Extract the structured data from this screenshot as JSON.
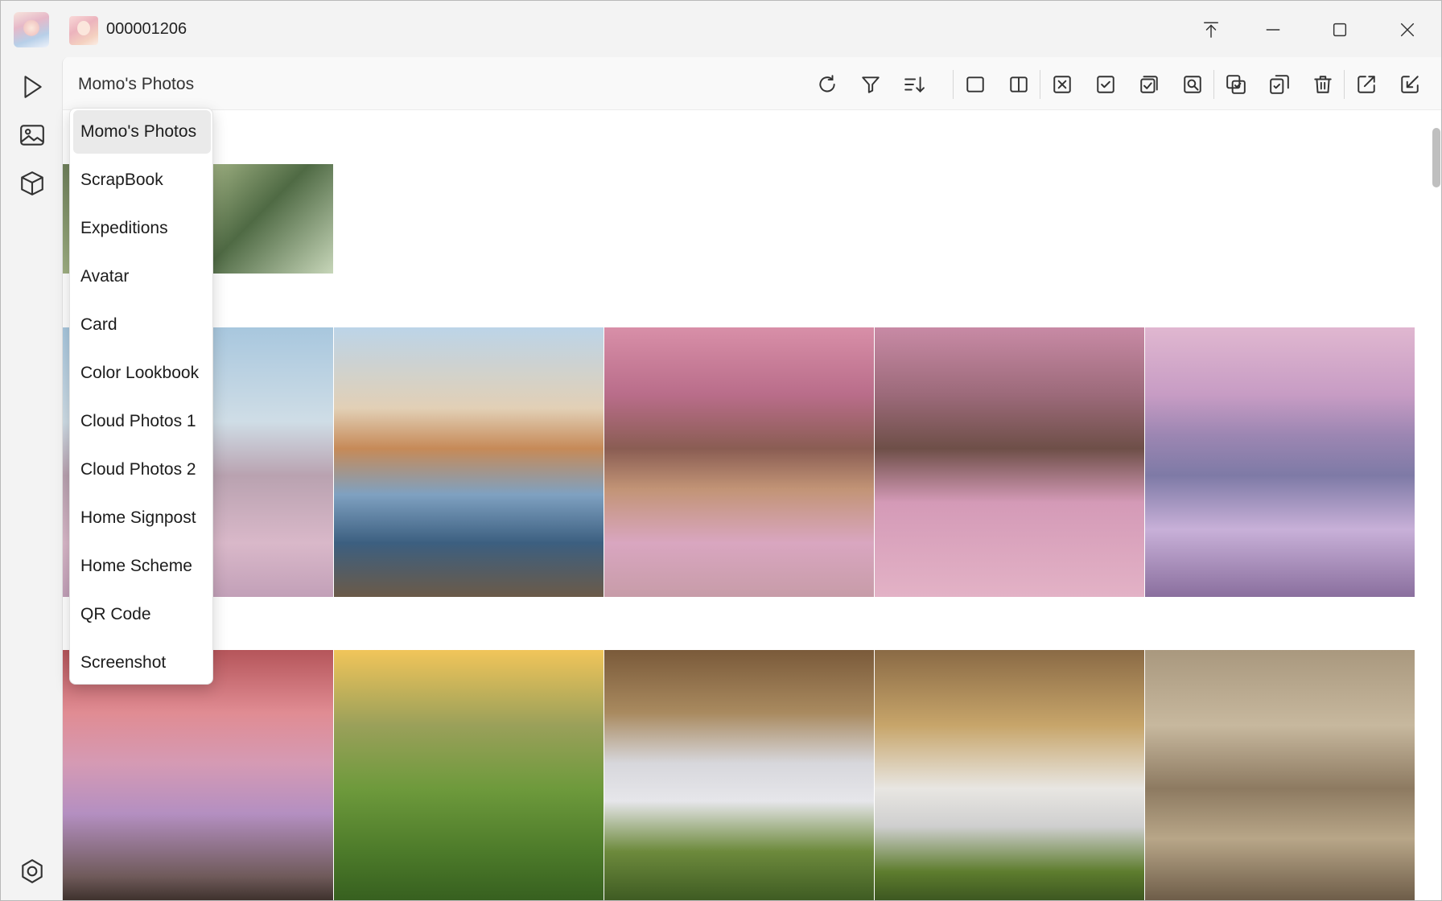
{
  "titlebar": {
    "uid": "000001206",
    "controls": {
      "pin": "pin-top-icon",
      "minimize": "minimize-icon",
      "maximize": "maximize-icon",
      "close": "close-icon"
    }
  },
  "nav": {
    "items": [
      {
        "name": "play",
        "icon": "play-icon"
      },
      {
        "name": "photos",
        "icon": "image-icon"
      },
      {
        "name": "models",
        "icon": "cube-icon"
      }
    ],
    "settings_icon": "settings-icon"
  },
  "toolbar": {
    "album_selected": "Momo's Photos",
    "tools": [
      "refresh-icon",
      "filter-icon",
      "sort-icon",
      "single-view-icon",
      "split-view-icon",
      "deselect-icon",
      "select-icon",
      "select-all-icon",
      "find-icon",
      "convert-icon",
      "sync-icon",
      "delete-icon",
      "export-icon",
      "import-icon"
    ]
  },
  "dropdown": {
    "items": [
      "Momo's Photos",
      "ScrapBook",
      "Expeditions",
      "Avatar",
      "Card",
      "Color Lookbook",
      "Cloud Photos 1",
      "Cloud Photos 2",
      "Home Signpost",
      "Home Scheme",
      "QR Code",
      "Screenshot"
    ],
    "selected_index": 0
  }
}
